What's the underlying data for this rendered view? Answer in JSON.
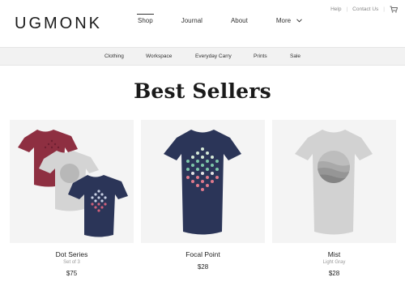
{
  "brand": {
    "logo": "UGMONK"
  },
  "utility_nav": {
    "help": "Help",
    "contact": "Contact Us",
    "cart_icon": "cart-icon"
  },
  "main_nav": {
    "shop": "Shop",
    "journal": "Journal",
    "about": "About",
    "more": "More",
    "active": "Shop"
  },
  "sub_nav": [
    "Clothing",
    "Workspace",
    "Everyday Carry",
    "Prints",
    "Sale"
  ],
  "page": {
    "title": "Best Sellers"
  },
  "products": [
    {
      "name": "Dot Series",
      "subtitle": "Set of 3",
      "price": "$75"
    },
    {
      "name": "Focal Point",
      "subtitle": "",
      "price": "$28"
    },
    {
      "name": "Mist",
      "subtitle": "Light Gray",
      "price": "$28"
    }
  ],
  "colors": {
    "maroon": "#8e2f41",
    "navy": "#2b3558",
    "light_gray": "#d2d2d2",
    "subnav_bg": "#f2f2f2"
  }
}
